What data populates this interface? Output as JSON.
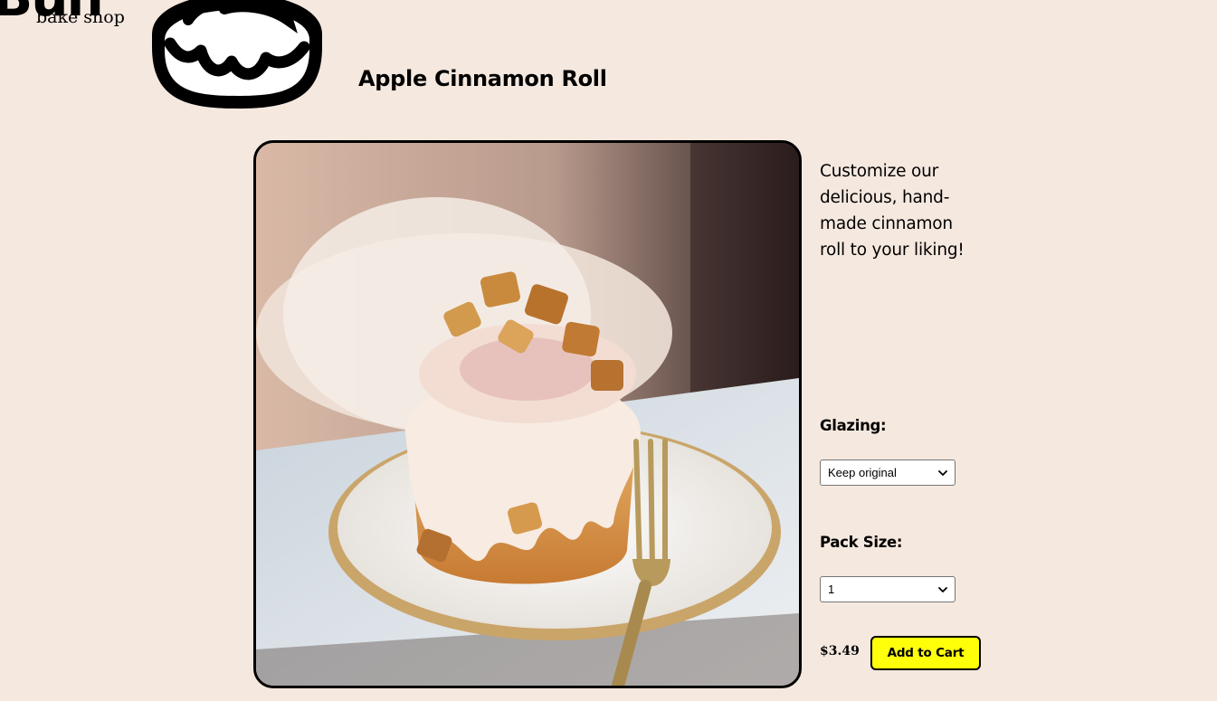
{
  "logo": {
    "word": "Bun",
    "subtitle": "bake shop",
    "icon": "cinnamon-bun-icon"
  },
  "product": {
    "title": "Apple Cinnamon Roll",
    "description": "Customize our delicious, hand-made cinnamon roll to your liking!",
    "image": "apple-cinnamon-roll-photo",
    "price": "$3.49"
  },
  "options": {
    "glazing": {
      "label": "Glazing:",
      "selected": "Keep original"
    },
    "pack_size": {
      "label": "Pack Size:",
      "selected": "1"
    }
  },
  "actions": {
    "add_to_cart": "Add to Cart"
  },
  "colors": {
    "background": "#f5e8df",
    "button": "#ffff0a",
    "border": "#000000"
  }
}
